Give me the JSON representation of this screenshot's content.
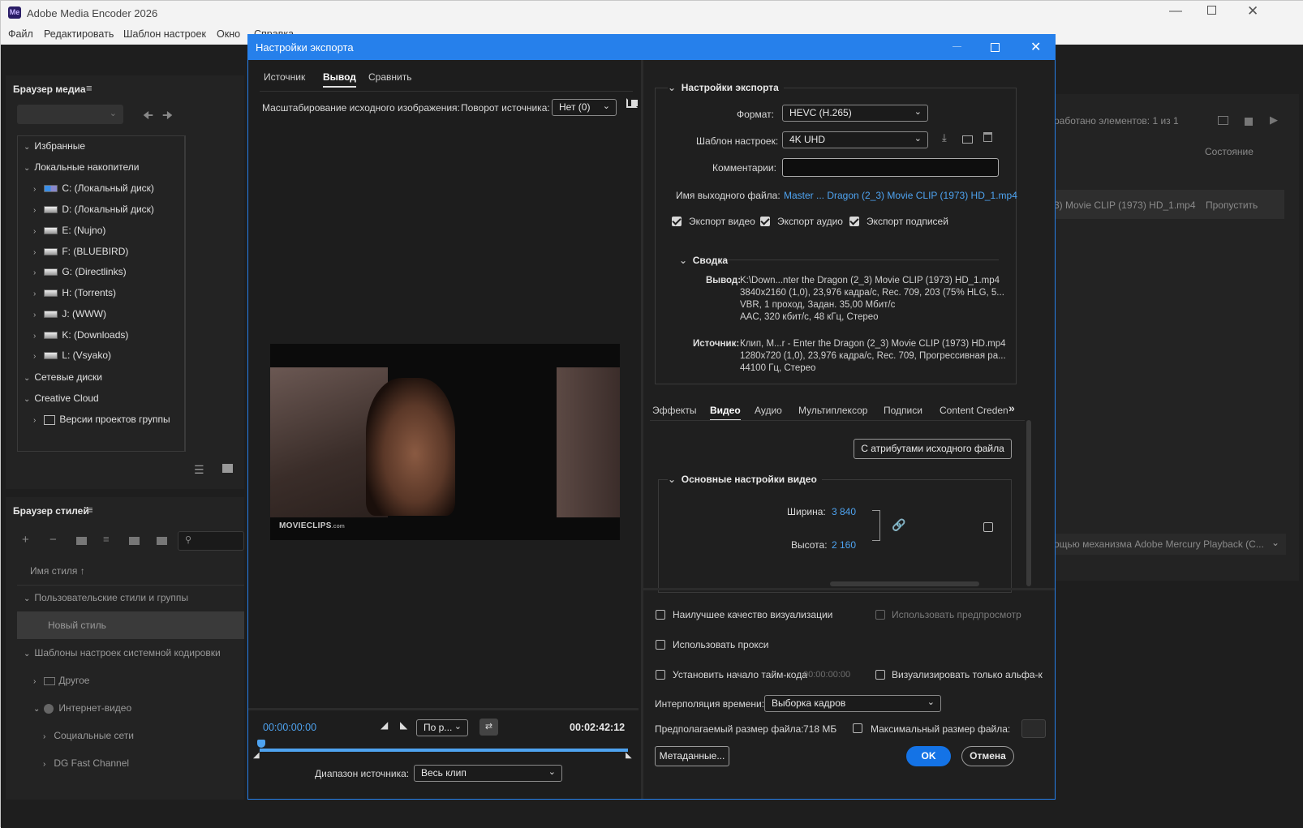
{
  "app": {
    "title": "Adobe Media Encoder 2026",
    "logo": "Me",
    "menu": [
      "Файл",
      "Редактировать",
      "Шаблон настроек",
      "Окно",
      "Справка"
    ]
  },
  "media_browser": {
    "title": "Браузер медиа",
    "tree": [
      {
        "label": "Избранные",
        "level": 0,
        "expanded": true
      },
      {
        "label": "Локальные накопители",
        "level": 0,
        "expanded": true
      },
      {
        "label": "C: (Локальный диск)",
        "level": 1
      },
      {
        "label": "D: (Локальный диск)",
        "level": 1
      },
      {
        "label": "E: (Nujno)",
        "level": 1
      },
      {
        "label": "F: (BLUEBIRD)",
        "level": 1
      },
      {
        "label": "G: (Directlinks)",
        "level": 1
      },
      {
        "label": "H: (Torrents)",
        "level": 1
      },
      {
        "label": "J: (WWW)",
        "level": 1
      },
      {
        "label": "K: (Downloads)",
        "level": 1
      },
      {
        "label": "L: (Vsyako)",
        "level": 1
      },
      {
        "label": "Сетевые диски",
        "level": 0,
        "expanded": true
      },
      {
        "label": "Creative Cloud",
        "level": 0,
        "expanded": true
      },
      {
        "label": "Версии проектов группы",
        "level": 1
      }
    ]
  },
  "style_browser": {
    "title": "Браузер стилей",
    "column": "Имя стиля",
    "items": [
      {
        "label": "Пользовательские стили и группы",
        "level": 0
      },
      {
        "label": "Новый стиль",
        "level": 1
      },
      {
        "label": "Шаблоны настроек системной кодировки",
        "level": 0
      },
      {
        "label": "Другое",
        "level": 1
      },
      {
        "label": "Интернет-видео",
        "level": 1
      },
      {
        "label": "Социальные сети",
        "level": 2
      },
      {
        "label": "DG Fast Channel",
        "level": 2
      }
    ]
  },
  "queue": {
    "processed": "работано элементов: 1 из 1",
    "status_header": "Состояние",
    "row_name": "3) Movie CLIP (1973) HD_1.mp4",
    "row_status": "Пропустить",
    "renderer": "ощью механизма Adobe Mercury Playback (C..."
  },
  "dialog": {
    "title": "Настройки экспорта",
    "tabs": [
      "Источник",
      "Вывод",
      "Сравнить"
    ],
    "scale_label": "Масштабирование исходного изображения:",
    "rotate_label": "Поворот источника:",
    "rotate_value": "Нет (0)",
    "watermark": "MOVIECLIPS",
    "watermark_suffix": ".com",
    "timecode_start": "00:00:00:00",
    "timecode_end": "00:02:42:12",
    "fit_value": "По р...",
    "range_label": "Диапазон источника:",
    "range_value": "Весь клип",
    "export_settings": {
      "title": "Настройки экспорта",
      "format_label": "Формат:",
      "format_value": "HEVC (H.265)",
      "preset_label": "Шаблон настроек:",
      "preset_value": "4K UHD",
      "comments_label": "Комментарии:",
      "output_label": "Имя выходного файла:",
      "output_value": "Master ... Dragon (2_3) Movie CLIP (1973) HD_1.mp4",
      "export_video": "Экспорт видео",
      "export_audio": "Экспорт аудио",
      "export_captions": "Экспорт подписей"
    },
    "summary": {
      "title": "Сводка",
      "output_label": "Вывод:",
      "output_lines": [
        "K:\\Down...nter the Dragon (2_3) Movie CLIP (1973) HD_1.mp4",
        "3840x2160 (1,0), 23,976 кадра/с, Rec. 709, 203 (75% HLG, 5...",
        "VBR, 1 проход, Задан. 35,00 Мбит/с",
        "AAC, 320 кбит/с, 48 кГц, Стерео"
      ],
      "source_label": "Источник:",
      "source_lines": [
        "Клип, M...r - Enter the Dragon (2_3) Movie CLIP (1973) HD.mp4",
        "1280x720 (1,0), 23,976 кадра/с, Rec. 709, Прогрессивная ра...",
        "44100 Гц, Стерео"
      ]
    },
    "settings_tabs": [
      "Эффекты",
      "Видео",
      "Аудио",
      "Мультиплексор",
      "Подписи",
      "Content Creden"
    ],
    "match_source": "С атрибутами исходного файла",
    "basic_video": {
      "title": "Основные настройки видео",
      "width_label": "Ширина:",
      "width_value": "3 840",
      "height_label": "Высота:",
      "height_value": "2 160"
    },
    "options": {
      "best_quality": "Наилучшее качество визуализации",
      "use_preview": "Использовать предпросмотр",
      "use_proxy": "Использовать прокси",
      "set_timecode": "Установить начало тайм-кода",
      "timecode_value": "00:00:00:00",
      "alpha_only": "Визуализировать только альфа-к",
      "interp_label": "Интерполяция времени:",
      "interp_value": "Выборка кадров",
      "est_size_label": "Предполагаемый размер файла:",
      "est_size_value": "718 МБ",
      "max_size": "Максимальный размер файла:"
    },
    "buttons": {
      "metadata": "Метаданные...",
      "ok": "OK",
      "cancel": "Отмена"
    }
  }
}
